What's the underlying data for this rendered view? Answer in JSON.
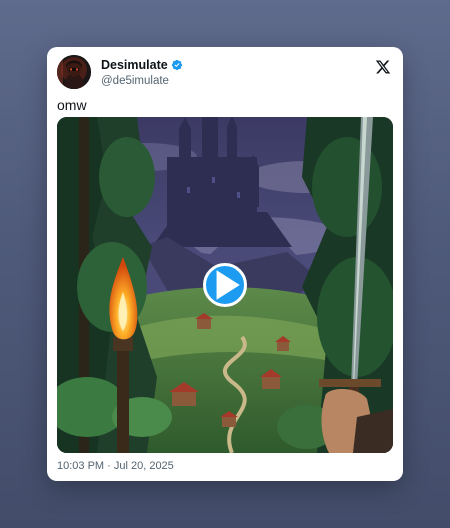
{
  "tweet": {
    "display_name": "Desimulate",
    "handle": "@de5imulate",
    "text": "omw",
    "timestamp": "10:03 PM · Jul 20, 2025",
    "verified": true,
    "platform_icon": "x-logo-icon",
    "media": {
      "type": "video",
      "play_icon": "play-icon",
      "accent_color": "#1d9bf0"
    }
  }
}
